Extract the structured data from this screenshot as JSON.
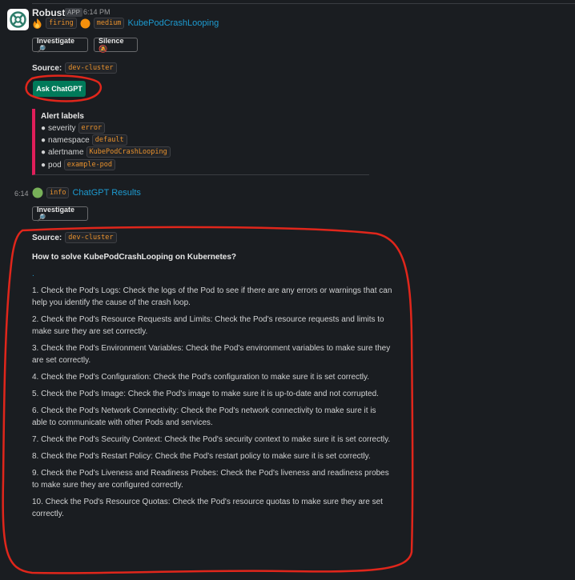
{
  "message1": {
    "sender": "Robusta",
    "app_badge": "APP",
    "time": "6:14 PM",
    "fire_icon": "fire-emoji",
    "status_code": "firing",
    "severity_icon": "orange-circle-emoji",
    "severity_code": "medium",
    "alert_title": "KubePodCrashLooping",
    "buttons": {
      "investigate": "Investigate 🔎",
      "silence": "Silence 🔕"
    },
    "source_label": "Source:",
    "source_value": "dev-cluster",
    "ask_chatgpt": "Ask ChatGPT",
    "alert_labels": {
      "title": "Alert labels",
      "items": [
        {
          "key": "severity",
          "value": "error"
        },
        {
          "key": "namespace",
          "value": "default"
        },
        {
          "key": "alertname",
          "value": "KubePodCrashLooping"
        },
        {
          "key": "pod",
          "value": "example-pod"
        }
      ]
    }
  },
  "message2": {
    "time": "6:14",
    "status_icon": "green-circle-emoji",
    "status_code": "info",
    "title": "ChatGPT Results",
    "investigate": "Investigate 🔎",
    "source_label": "Source:",
    "source_value": "dev-cluster",
    "question": "How to solve KubePodCrashLooping on Kubernetes?",
    "dot": ".",
    "answers": [
      "1. Check the Pod's Logs: Check the logs of the Pod to see if there are any errors or warnings that can help you identify the cause of the crash loop.",
      "2. Check the Pod's Resource Requests and Limits: Check the Pod's resource requests and limits to make sure they are set correctly.",
      "3. Check the Pod's Environment Variables: Check the Pod's environment variables to make sure they are set correctly.",
      "4. Check the Pod's Configuration: Check the Pod's configuration to make sure it is set correctly.",
      "5. Check the Pod's Image: Check the Pod's image to make sure it is up-to-date and not corrupted.",
      "6. Check the Pod's Network Connectivity: Check the Pod's network connectivity to make sure it is able to communicate with other Pods and services.",
      "7. Check the Pod's Security Context: Check the Pod's security context to make sure it is set correctly.",
      "8. Check the Pod's Restart Policy: Check the Pod's restart policy to make sure it is set correctly.",
      "9. Check the Pod's Liveness and Readiness Probes: Check the Pod's liveness and readiness probes to make sure they are configured correctly.",
      "10. Check the Pod's Resource Quotas: Check the Pod's resource quotas to make sure they are set correctly."
    ]
  },
  "colors": {
    "background": "#1a1d21",
    "link": "#1d9bd1",
    "code": "#e8912d",
    "attachment_bar": "#e01e5a",
    "primary_button": "#007a5a",
    "annotation": "#e0261b"
  }
}
